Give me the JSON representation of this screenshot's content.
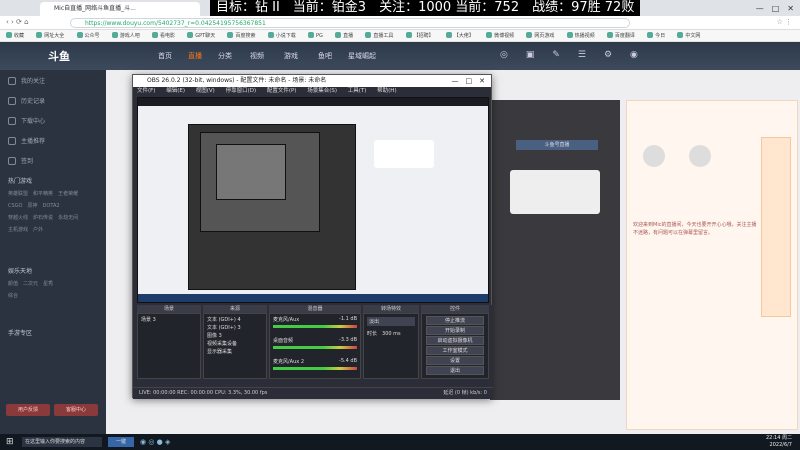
{
  "ticker": "目标：钻 II　当前：铂金3　关注：1000 当前：752　战绩：97胜 72败",
  "browser": {
    "tab_title": "Mic自直播_网络斗鱼直播_斗...",
    "url": "https://www.douyu.com/5402737_r=0.04254195756367851",
    "bookmarks": [
      "收藏",
      "网址大全",
      "公众号",
      "游戏人吧",
      "看电影",
      "GPT聊天",
      "百度搜索",
      "小说下载",
      "PG",
      "直播",
      "直播工具",
      "【招聘】",
      "【大佬】",
      "微博视频",
      "网页游戏",
      "热播视频",
      "百度翻译",
      "今日",
      "中文网",
      "看视频",
      "百度Q",
      "网盘",
      "https:"
    ]
  },
  "site": {
    "logo": "斗鱼",
    "nav": [
      "首页",
      "直播",
      "分类",
      "视频",
      "游戏",
      "鱼吧",
      "星域崛起"
    ]
  },
  "sidebar": {
    "items": [
      "我的关注",
      "历史记录",
      "下载中心",
      "主播推荐",
      "签到"
    ],
    "sections": [
      "热门游戏",
      "娱乐天地",
      "手游专区"
    ],
    "grid": [
      "英雄联盟",
      "和平精英",
      "王者荣耀",
      "CSGO",
      "原神",
      "DOTA2",
      "穿越火线",
      "炉石传说",
      "永劫无间",
      "主机游戏",
      "户外",
      "颜值",
      "二次元",
      "星秀",
      "综合"
    ],
    "buttons": [
      "用户反馈",
      "客服中心"
    ]
  },
  "obs": {
    "title": "OBS 26.0.2 (32-bit, windows) - 配置文件: 未命名 - 场景: 未命名",
    "menu": [
      "文件(F)",
      "编辑(E)",
      "视图(V)",
      "停靠窗口(D)",
      "配置文件(P)",
      "场景集合(S)",
      "工具(T)",
      "帮助(H)"
    ],
    "docks": {
      "scenes": "场景",
      "sources": "来源",
      "mixer": "混音器",
      "transitions": "转场特效",
      "controls": "控件"
    },
    "scene_item": "场景 3",
    "sources_list": [
      "文本 (GDI+) 4",
      "文本 (GDI+) 3",
      "图像 3",
      "视频采集设备",
      "显示器采集"
    ],
    "mixer_channels": [
      {
        "name": "麦克风/Aux",
        "value": "-1.1 dB"
      },
      {
        "name": "桌面音频",
        "value": "-3.3 dB"
      },
      {
        "name": "麦克风/Aux 2",
        "value": "-5.4 dB"
      }
    ],
    "transition": "淡出",
    "duration_label": "时长",
    "duration_value": "300 ms",
    "controls": [
      "停止推流",
      "开始录制",
      "启动虚拟摄像机",
      "工作室模式",
      "设置",
      "退出"
    ],
    "status": "LIVE: 00:00:00  REC: 00:00:00  CPU: 3.3%, 30.00 fps",
    "status_right": "延迟 (0 帧)  kb/s: 0"
  },
  "page": {
    "anchor": "斗鱼号直播",
    "notice": "欢迎来到Mic的直播间，今天也要开开心心哦，关注主播不迷路，有问题可以在弹幕里留言。",
    "tags": [
      "主播",
      "粉丝团",
      "贵族"
    ]
  },
  "taskbar": {
    "start": "⊞",
    "search": "在这里输入你要搜索的内容",
    "app": "一键",
    "time": "22:14 周二",
    "date": "2022/6/7"
  }
}
